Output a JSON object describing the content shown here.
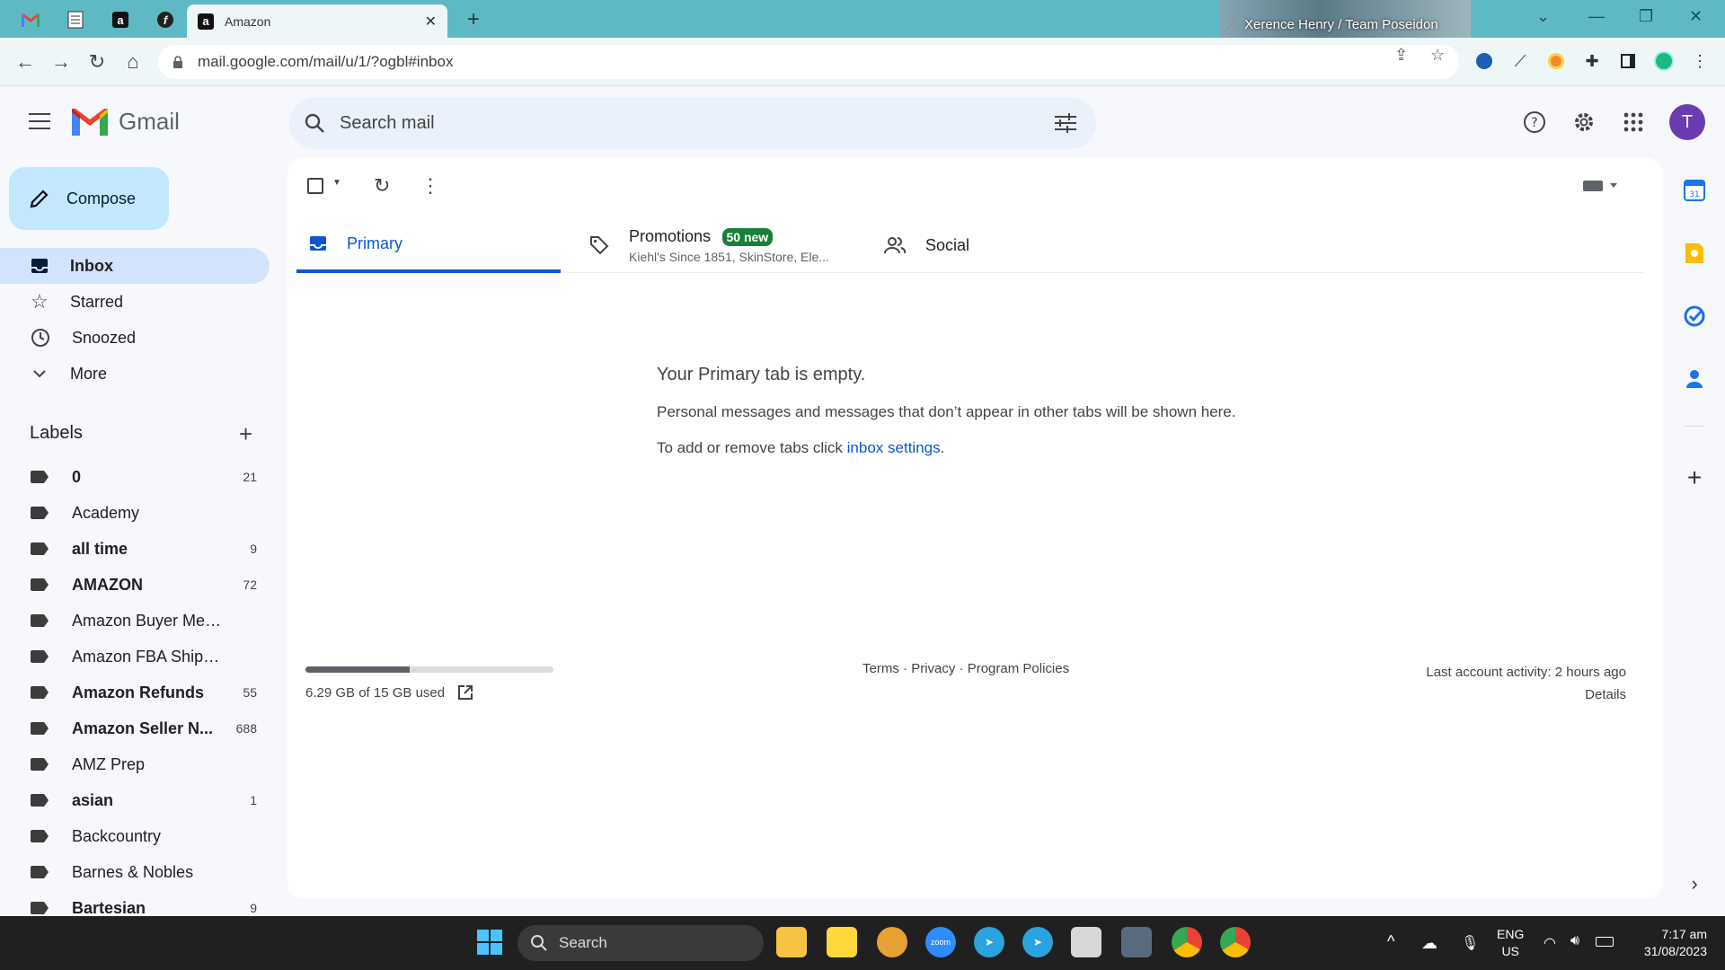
{
  "browser": {
    "active_tab_title": "Amazon",
    "video_tile_name": "Xerence Henry / Team Poseidon",
    "url": "mail.google.com/mail/u/1/?ogbl#inbox"
  },
  "gmail": {
    "logo_text": "Gmail",
    "search_placeholder": "Search mail",
    "avatar_letter": "T",
    "compose_label": "Compose",
    "nav": [
      {
        "label": "Inbox",
        "icon": "inbox-icon",
        "active": true
      },
      {
        "label": "Starred",
        "icon": "star-icon"
      },
      {
        "label": "Snoozed",
        "icon": "clock-icon"
      },
      {
        "label": "More",
        "icon": "chevron-down-icon"
      }
    ],
    "labels_title": "Labels",
    "labels": [
      {
        "name": "0",
        "count": "21",
        "bold": true
      },
      {
        "name": "Academy",
        "count": "",
        "bold": false
      },
      {
        "name": "all time",
        "count": "9",
        "bold": true
      },
      {
        "name": "AMAZON",
        "count": "72",
        "bold": true
      },
      {
        "name": "Amazon Buyer Message",
        "count": "",
        "bold": false
      },
      {
        "name": "Amazon FBA Shipments",
        "count": "",
        "bold": false
      },
      {
        "name": "Amazon Refunds",
        "count": "55",
        "bold": true
      },
      {
        "name": "Amazon Seller N...",
        "count": "688",
        "bold": true
      },
      {
        "name": "AMZ Prep",
        "count": "",
        "bold": false
      },
      {
        "name": "asian",
        "count": "1",
        "bold": true
      },
      {
        "name": "Backcountry",
        "count": "",
        "bold": false
      },
      {
        "name": "Barnes & Nobles",
        "count": "",
        "bold": false
      },
      {
        "name": "Bartesian",
        "count": "9",
        "bold": true
      }
    ],
    "tabs": {
      "primary": "Primary",
      "promotions": "Promotions",
      "promotions_badge": "50 new",
      "promotions_sub": "Kiehl's Since 1851, SkinStore, Ele...",
      "social": "Social"
    },
    "empty": {
      "title": "Your Primary tab is empty.",
      "line1": "Personal messages and messages that don’t appear in other tabs will be shown here.",
      "line2_prefix": "To add or remove tabs click ",
      "line2_link": "inbox settings",
      "line2_suffix": "."
    },
    "storage": {
      "text": "6.29 GB of 15 GB used",
      "fraction": 0.419
    },
    "footer": {
      "terms": "Terms",
      "privacy": "Privacy",
      "policies": "Program Policies",
      "sep": " · ",
      "activity": "Last account activity: 2 hours ago",
      "details": "Details"
    }
  },
  "taskbar": {
    "search_label": "Search",
    "lang_top": "ENG",
    "lang_bottom": "US",
    "time": "7:17 am",
    "date": "31/08/2023"
  }
}
